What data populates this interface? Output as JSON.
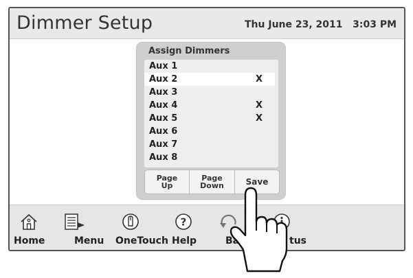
{
  "header": {
    "title": "Dimmer Setup",
    "datetime": "Thu June 23, 2011   3:03 PM"
  },
  "dialog": {
    "title": "Assign Dimmers",
    "items": [
      {
        "label": "Aux 1",
        "mark": ""
      },
      {
        "label": "Aux 2",
        "mark": "X",
        "selected": true
      },
      {
        "label": "Aux 3",
        "mark": ""
      },
      {
        "label": "Aux 4",
        "mark": "X"
      },
      {
        "label": "Aux 5",
        "mark": "X"
      },
      {
        "label": "Aux 6",
        "mark": ""
      },
      {
        "label": "Aux 7",
        "mark": ""
      },
      {
        "label": "Aux 8",
        "mark": ""
      }
    ],
    "buttons": {
      "page_up_line1": "Page",
      "page_up_line2": "Up",
      "page_down_line1": "Page",
      "page_down_line2": "Down",
      "save": "Save"
    }
  },
  "nav": {
    "home": "Home",
    "menu": "Menu",
    "onetouch": "OneTouch",
    "help": "Help",
    "back": "Ba",
    "status": "tus"
  },
  "icons": {
    "home": "home-icon",
    "menu": "menu-icon",
    "onetouch": "onetouch-icon",
    "help": "help-icon",
    "back": "back-icon",
    "status": "info-icon",
    "pointer": "pointing-hand-icon"
  }
}
